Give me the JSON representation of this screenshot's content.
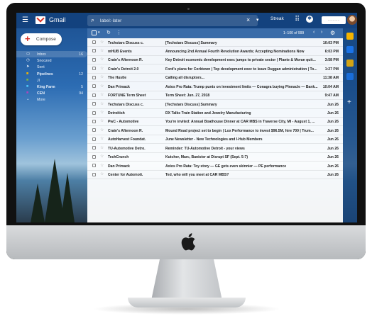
{
  "header": {
    "brand": "Gmail",
    "search_value": "label:-later",
    "search_close": "×",
    "search_options": "▾",
    "streak": "Streak",
    "account_label": "............"
  },
  "compose": {
    "label": "Compose"
  },
  "nav": [
    {
      "icon": "inbox-icon",
      "glyph": "▭",
      "label": "Inbox",
      "count": "16",
      "active": true
    },
    {
      "icon": "snoozed-icon",
      "glyph": "◷",
      "label": "Snoozed",
      "count": ""
    },
    {
      "icon": "sent-icon",
      "glyph": "➤",
      "label": "Sent",
      "count": ""
    },
    {
      "icon": "label-icon",
      "glyph": "■",
      "label": "Pipelines",
      "count": "12"
    },
    {
      "icon": "label-icon",
      "glyph": "■",
      "label": "JI",
      "count": ""
    },
    {
      "icon": "label-icon",
      "glyph": "■",
      "label": "King Farm",
      "count": "5"
    },
    {
      "icon": "label-icon",
      "glyph": "■",
      "label": "CEN",
      "count": "94"
    },
    {
      "icon": "more-icon",
      "glyph": "⌄",
      "label": "More",
      "count": ""
    }
  ],
  "toolbar": {
    "range": "1–100 of 999",
    "refresh": "↻",
    "more": "⋮",
    "prev": "‹",
    "next": "›",
    "gear": "⚙"
  },
  "emails": [
    {
      "sender": "Techstars Discuss c.",
      "subject": "[Techstars Discuss] Summary",
      "date": "10:03 PM",
      "read": false
    },
    {
      "sender": "mHUB Events",
      "subject": "Announcing 2nd Annual Fourth Revolution Awards; Accepting Nominations Now",
      "date": "6:03 PM",
      "read": false
    },
    {
      "sender": "Crain's Afternoon R.",
      "subject": "Key Detroit economic development exec jumps to private sector | Plante & Moran quit...",
      "date": "3:58 PM",
      "read": false
    },
    {
      "sender": "Crain's Detroit 2.0",
      "subject": "Ford's plans for Corktown | Top development exec to leave Duggan administration | To...",
      "date": "1:27 PM",
      "read": false
    },
    {
      "sender": "The Hustle",
      "subject": "Calling all disruptors...",
      "date": "11:38 AM",
      "read": false
    },
    {
      "sender": "Dan Primack",
      "subject": "Axios Pro Rata: Trump punts on investment limits — Conagra buying Pinnacle — Bank...",
      "date": "10:04 AM",
      "read": false
    },
    {
      "sender": "FORTUNE Term Sheet",
      "subject": "Term Sheet: Jun. 27, 2018",
      "date": "9:47 AM",
      "read": false
    },
    {
      "sender": "Techstars Discuss c.",
      "subject": "[Techstars Discuss] Summary",
      "date": "Jun 26",
      "read": false
    },
    {
      "sender": "Detroitish",
      "subject": "DX Talks Train Station and Jewelry Manufacturing",
      "date": "Jun 26",
      "read": false
    },
    {
      "sender": "PwC - Automotive",
      "subject": "You're invited: Annual Boathouse Dinner at CAR MBS in Traverse City, MI - August 1, ...",
      "date": "Jun 26",
      "read": false
    },
    {
      "sender": "Crain's Afternoon R.",
      "subject": "Mound Road project set to begin | Lox Performance to invest $96.5M, hire 700 | Trum...",
      "date": "Jun 26",
      "read": false
    },
    {
      "sender": "AutoHarvest Foundat.",
      "subject": "June Newsletter - New Technologies and I-Hub Members",
      "date": "Jun 26",
      "read": false
    },
    {
      "sender": "TU-Automotive Detro.",
      "subject": "Reminder: TU-Automotive Detroit - your views",
      "date": "Jun 26",
      "read": false
    },
    {
      "sender": "TechCrunch",
      "subject": "Kutcher, Marc, Banister at Disrupt SF (Sept. 5-7)",
      "date": "Jun 26",
      "read": false
    },
    {
      "sender": "Dan Primack",
      "subject": "Axios Pro Rata: Toy story — GE gets even skinnier — PE performance",
      "date": "Jun 26",
      "read": false
    },
    {
      "sender": "Center for Automoti.",
      "subject": "Ted, who will you meet at CAR MBS?",
      "date": "Jun 26",
      "read": false
    }
  ],
  "colors": {
    "accent": "#d93025",
    "toolbar": "#265da0",
    "sidepanel_icons": [
      "#f4b400",
      "#1a73e8",
      "#f4b400",
      "#1a73e8"
    ]
  }
}
